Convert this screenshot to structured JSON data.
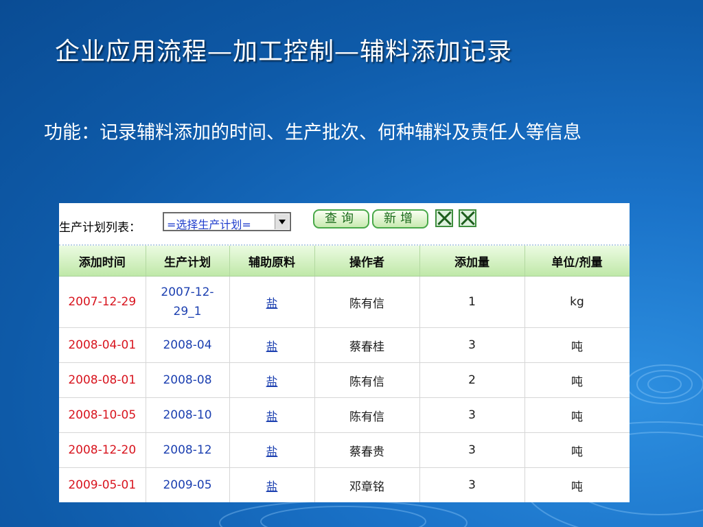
{
  "slide": {
    "title": "企业应用流程—加工控制—辅料添加记录",
    "description": "功能：记录辅料添加的时间、生产批次、何种辅料及责任人等信息"
  },
  "toolbar": {
    "label": "生产计划列表：",
    "select_value": "=选择生产计划=",
    "query_button": "查询",
    "add_button": "新增",
    "export_icon_1": "excel-icon",
    "export_icon_2": "excel-icon"
  },
  "table": {
    "columns": [
      "添加时间",
      "生产计划",
      "辅助原料",
      "操作者",
      "添加量",
      "单位/剂量"
    ],
    "rows": [
      {
        "time": "2007-12-29",
        "plan": "2007-12-29_1",
        "material": "盐",
        "operator": "陈有信",
        "amount": "1",
        "unit": "kg"
      },
      {
        "time": "2008-04-01",
        "plan": "2008-04",
        "material": "盐",
        "operator": "蔡春桂",
        "amount": "3",
        "unit": "吨"
      },
      {
        "time": "2008-08-01",
        "plan": "2008-08",
        "material": "盐",
        "operator": "陈有信",
        "amount": "2",
        "unit": "吨"
      },
      {
        "time": "2008-10-05",
        "plan": "2008-10",
        "material": "盐",
        "operator": "陈有信",
        "amount": "3",
        "unit": "吨"
      },
      {
        "time": "2008-12-20",
        "plan": "2008-12",
        "material": "盐",
        "operator": "蔡春贵",
        "amount": "3",
        "unit": "吨"
      },
      {
        "time": "2009-05-01",
        "plan": "2009-05",
        "material": "盐",
        "operator": "邓章铭",
        "amount": "3",
        "unit": "吨"
      }
    ]
  },
  "colors": {
    "background": "#1a72c8",
    "header_green": "#bfe8a8",
    "date_red": "#d8141e",
    "link_blue": "#1b3fb0"
  }
}
